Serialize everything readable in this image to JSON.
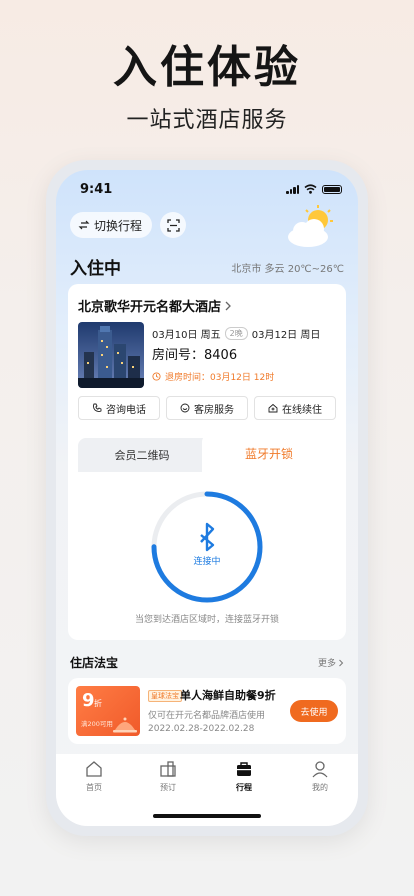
{
  "hero": {
    "title": "入住体验",
    "subtitle": "一站式酒店服务"
  },
  "status_bar": {
    "time": "9:41"
  },
  "header": {
    "switch_label": "切换行程",
    "section_title": "入住中",
    "weather": "北京市 多云 20℃~26℃"
  },
  "hotel": {
    "name": "北京歌华开元名都大酒店",
    "checkin": "03月10日 周五",
    "nights": "2晚",
    "checkout": "03月12日 周日",
    "room": "房间号：8406",
    "checkout_time": "退房时间：03月12日 12时"
  },
  "actions": [
    {
      "label": "咨询电话",
      "icon": "phone-icon"
    },
    {
      "label": "客房服务",
      "icon": "service-icon"
    },
    {
      "label": "在线续住",
      "icon": "house-icon"
    }
  ],
  "tabs": {
    "left": "会员二维码",
    "right": "蓝牙开锁"
  },
  "bluetooth": {
    "status": "连接中",
    "hint": "当您到达酒店区域时，连接蓝牙开锁",
    "progress": 0.75
  },
  "perks": {
    "title": "住店法宝",
    "more": "更多",
    "item": {
      "coupon_value": "9",
      "coupon_unit": "折",
      "coupon_condition": "满200可用",
      "badge": "皇球法宝",
      "title": "单人海鲜自助餐9折",
      "desc": "仅可在开元名都品牌酒店使用",
      "date": "2022.02.28-2022.02.28",
      "button": "去使用"
    }
  },
  "tabbar": [
    {
      "label": "首页",
      "icon": "home-icon"
    },
    {
      "label": "预订",
      "icon": "booking-icon"
    },
    {
      "label": "行程",
      "icon": "trip-icon",
      "active": true
    },
    {
      "label": "我的",
      "icon": "profile-icon"
    }
  ],
  "colors": {
    "accent": "#f07a2a",
    "bluetooth": "#1e7be0"
  }
}
